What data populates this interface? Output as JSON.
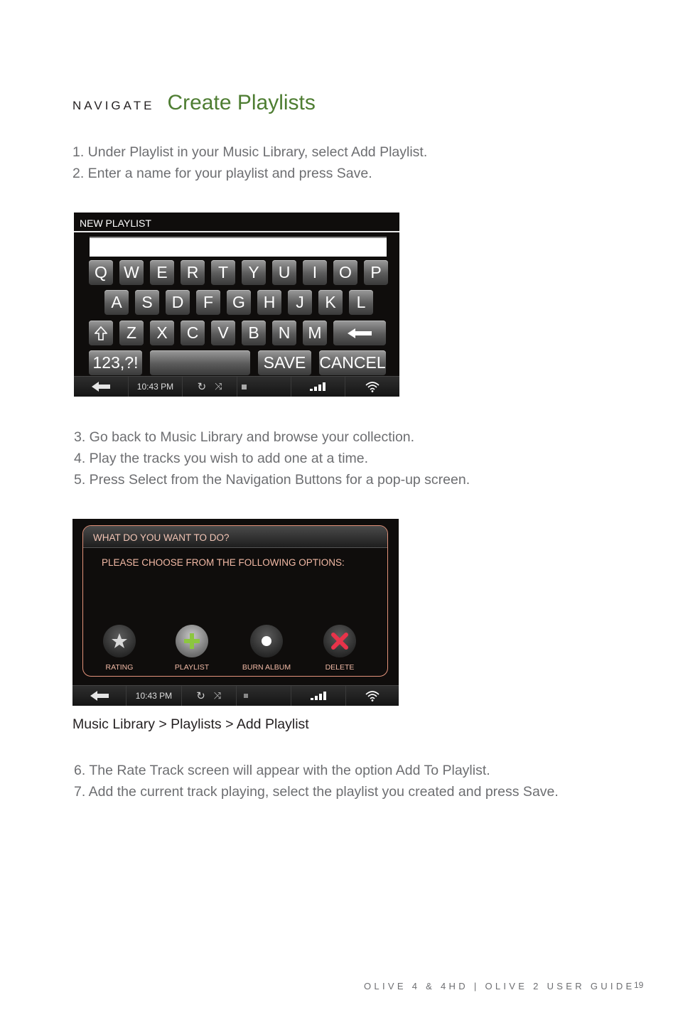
{
  "heading": {
    "kicker": "NAVIGATE",
    "title": "Create Playlists"
  },
  "steps_a": [
    "1. Under Playlist in your Music Library, select Add Playlist.",
    "2. Enter a name for your playlist and press Save."
  ],
  "keyboard_screen": {
    "header": "NEW PLAYLIST",
    "input_value": "",
    "rows": [
      [
        "Q",
        "W",
        "E",
        "R",
        "T",
        "Y",
        "U",
        "I",
        "O",
        "P"
      ],
      [
        "A",
        "S",
        "D",
        "F",
        "G",
        "H",
        "J",
        "K",
        "L"
      ],
      [
        "Z",
        "X",
        "C",
        "V",
        "B",
        "N",
        "M"
      ]
    ],
    "shift_icon": "shift-arrow-icon",
    "backspace_icon": "backspace-arrow-icon",
    "numbers_label": "123,?!",
    "space_label": "",
    "save_label": "SAVE",
    "cancel_label": "CANCEL",
    "status": {
      "time": "10:43 PM"
    }
  },
  "steps_b": [
    "3. Go back to Music Library and browse your collection.",
    "4. Play the tracks you wish to add one at a time.",
    "5. Press Select from the Navigation Buttons for a pop-up screen."
  ],
  "popup_screen": {
    "title": "WHAT DO YOU WANT TO DO?",
    "subtitle": "PLEASE CHOOSE FROM THE FOLLOWING OPTIONS:",
    "options": [
      {
        "label": "RATING",
        "icon": "star-icon"
      },
      {
        "label": "PLAYLIST",
        "icon": "plus-icon"
      },
      {
        "label": "BURN ALBUM",
        "icon": "disc-icon"
      },
      {
        "label": "DELETE",
        "icon": "x-icon"
      }
    ],
    "status": {
      "time": "10:43 PM"
    }
  },
  "caption": "Music Library > Playlists > Add Playlist",
  "steps_c": [
    "6. The Rate Track screen will appear with the option Add To Playlist.",
    "7. Add the current track playing, select the playlist you created and press Save."
  ],
  "footer": {
    "guide": "OLIVE 4 & 4HD | OLIVE 2 USER GUIDE",
    "page": "19"
  },
  "colors": {
    "title_green": "#4e7d32",
    "popup_accent": "#e3927a",
    "plus_green": "#8cc63f",
    "delete_red": "#e8334a"
  }
}
